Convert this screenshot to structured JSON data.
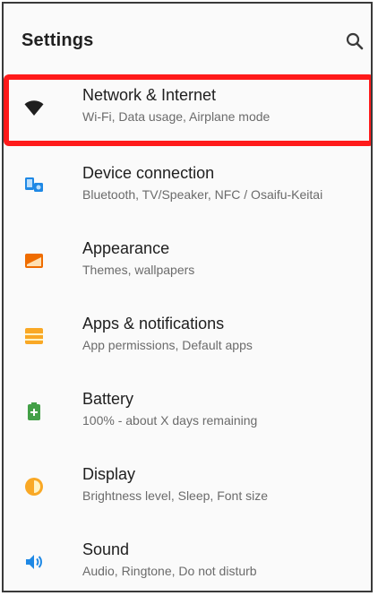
{
  "appbar": {
    "title": "Settings",
    "search_icon": "search-icon"
  },
  "items": [
    {
      "title": "Network & Internet",
      "subtitle": "Wi-Fi, Data usage, Airplane mode",
      "icon": "wifi-icon",
      "color": "#1f1f1f"
    },
    {
      "title": "Device connection",
      "subtitle": "Bluetooth, TV/Speaker, NFC / Osaifu-Keitai",
      "icon": "device-connection-icon",
      "color": "#1e88e5"
    },
    {
      "title": "Appearance",
      "subtitle": "Themes, wallpapers",
      "icon": "appearance-icon",
      "color": "#ef6c00"
    },
    {
      "title": "Apps & notifications",
      "subtitle": "App permissions, Default apps",
      "icon": "apps-icon",
      "color": "#f9a825"
    },
    {
      "title": "Battery",
      "subtitle": "100% - about X days remaining",
      "icon": "battery-icon",
      "color": "#43a047"
    },
    {
      "title": "Display",
      "subtitle": "Brightness level, Sleep, Font size",
      "icon": "display-icon",
      "color": "#f9a825"
    },
    {
      "title": "Sound",
      "subtitle": "Audio, Ringtone, Do not disturb",
      "icon": "sound-icon",
      "color": "#1e88e5"
    }
  ]
}
